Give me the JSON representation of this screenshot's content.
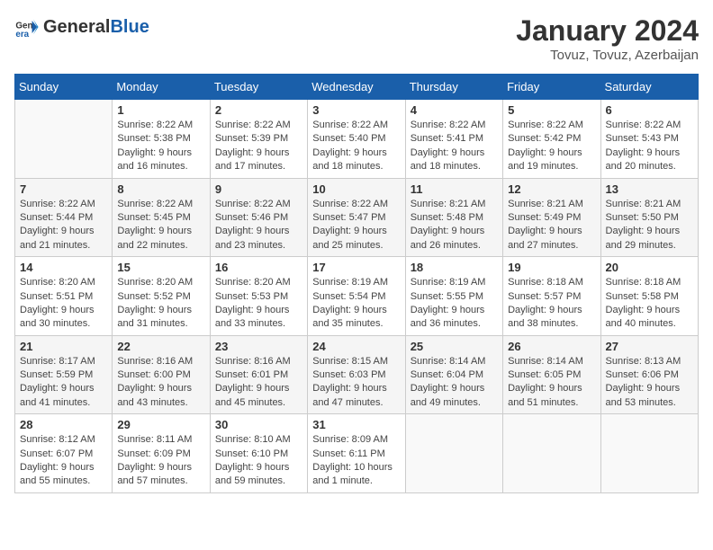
{
  "header": {
    "logo_general": "General",
    "logo_blue": "Blue",
    "month": "January 2024",
    "location": "Tovuz, Tovuz, Azerbaijan"
  },
  "columns": [
    "Sunday",
    "Monday",
    "Tuesday",
    "Wednesday",
    "Thursday",
    "Friday",
    "Saturday"
  ],
  "weeks": [
    [
      {
        "day": "",
        "info": ""
      },
      {
        "day": "1",
        "info": "Sunrise: 8:22 AM\nSunset: 5:38 PM\nDaylight: 9 hours\nand 16 minutes."
      },
      {
        "day": "2",
        "info": "Sunrise: 8:22 AM\nSunset: 5:39 PM\nDaylight: 9 hours\nand 17 minutes."
      },
      {
        "day": "3",
        "info": "Sunrise: 8:22 AM\nSunset: 5:40 PM\nDaylight: 9 hours\nand 18 minutes."
      },
      {
        "day": "4",
        "info": "Sunrise: 8:22 AM\nSunset: 5:41 PM\nDaylight: 9 hours\nand 18 minutes."
      },
      {
        "day": "5",
        "info": "Sunrise: 8:22 AM\nSunset: 5:42 PM\nDaylight: 9 hours\nand 19 minutes."
      },
      {
        "day": "6",
        "info": "Sunrise: 8:22 AM\nSunset: 5:43 PM\nDaylight: 9 hours\nand 20 minutes."
      }
    ],
    [
      {
        "day": "7",
        "info": "Sunrise: 8:22 AM\nSunset: 5:44 PM\nDaylight: 9 hours\nand 21 minutes."
      },
      {
        "day": "8",
        "info": "Sunrise: 8:22 AM\nSunset: 5:45 PM\nDaylight: 9 hours\nand 22 minutes."
      },
      {
        "day": "9",
        "info": "Sunrise: 8:22 AM\nSunset: 5:46 PM\nDaylight: 9 hours\nand 23 minutes."
      },
      {
        "day": "10",
        "info": "Sunrise: 8:22 AM\nSunset: 5:47 PM\nDaylight: 9 hours\nand 25 minutes."
      },
      {
        "day": "11",
        "info": "Sunrise: 8:21 AM\nSunset: 5:48 PM\nDaylight: 9 hours\nand 26 minutes."
      },
      {
        "day": "12",
        "info": "Sunrise: 8:21 AM\nSunset: 5:49 PM\nDaylight: 9 hours\nand 27 minutes."
      },
      {
        "day": "13",
        "info": "Sunrise: 8:21 AM\nSunset: 5:50 PM\nDaylight: 9 hours\nand 29 minutes."
      }
    ],
    [
      {
        "day": "14",
        "info": "Sunrise: 8:20 AM\nSunset: 5:51 PM\nDaylight: 9 hours\nand 30 minutes."
      },
      {
        "day": "15",
        "info": "Sunrise: 8:20 AM\nSunset: 5:52 PM\nDaylight: 9 hours\nand 31 minutes."
      },
      {
        "day": "16",
        "info": "Sunrise: 8:20 AM\nSunset: 5:53 PM\nDaylight: 9 hours\nand 33 minutes."
      },
      {
        "day": "17",
        "info": "Sunrise: 8:19 AM\nSunset: 5:54 PM\nDaylight: 9 hours\nand 35 minutes."
      },
      {
        "day": "18",
        "info": "Sunrise: 8:19 AM\nSunset: 5:55 PM\nDaylight: 9 hours\nand 36 minutes."
      },
      {
        "day": "19",
        "info": "Sunrise: 8:18 AM\nSunset: 5:57 PM\nDaylight: 9 hours\nand 38 minutes."
      },
      {
        "day": "20",
        "info": "Sunrise: 8:18 AM\nSunset: 5:58 PM\nDaylight: 9 hours\nand 40 minutes."
      }
    ],
    [
      {
        "day": "21",
        "info": "Sunrise: 8:17 AM\nSunset: 5:59 PM\nDaylight: 9 hours\nand 41 minutes."
      },
      {
        "day": "22",
        "info": "Sunrise: 8:16 AM\nSunset: 6:00 PM\nDaylight: 9 hours\nand 43 minutes."
      },
      {
        "day": "23",
        "info": "Sunrise: 8:16 AM\nSunset: 6:01 PM\nDaylight: 9 hours\nand 45 minutes."
      },
      {
        "day": "24",
        "info": "Sunrise: 8:15 AM\nSunset: 6:03 PM\nDaylight: 9 hours\nand 47 minutes."
      },
      {
        "day": "25",
        "info": "Sunrise: 8:14 AM\nSunset: 6:04 PM\nDaylight: 9 hours\nand 49 minutes."
      },
      {
        "day": "26",
        "info": "Sunrise: 8:14 AM\nSunset: 6:05 PM\nDaylight: 9 hours\nand 51 minutes."
      },
      {
        "day": "27",
        "info": "Sunrise: 8:13 AM\nSunset: 6:06 PM\nDaylight: 9 hours\nand 53 minutes."
      }
    ],
    [
      {
        "day": "28",
        "info": "Sunrise: 8:12 AM\nSunset: 6:07 PM\nDaylight: 9 hours\nand 55 minutes."
      },
      {
        "day": "29",
        "info": "Sunrise: 8:11 AM\nSunset: 6:09 PM\nDaylight: 9 hours\nand 57 minutes."
      },
      {
        "day": "30",
        "info": "Sunrise: 8:10 AM\nSunset: 6:10 PM\nDaylight: 9 hours\nand 59 minutes."
      },
      {
        "day": "31",
        "info": "Sunrise: 8:09 AM\nSunset: 6:11 PM\nDaylight: 10 hours\nand 1 minute."
      },
      {
        "day": "",
        "info": ""
      },
      {
        "day": "",
        "info": ""
      },
      {
        "day": "",
        "info": ""
      }
    ]
  ]
}
